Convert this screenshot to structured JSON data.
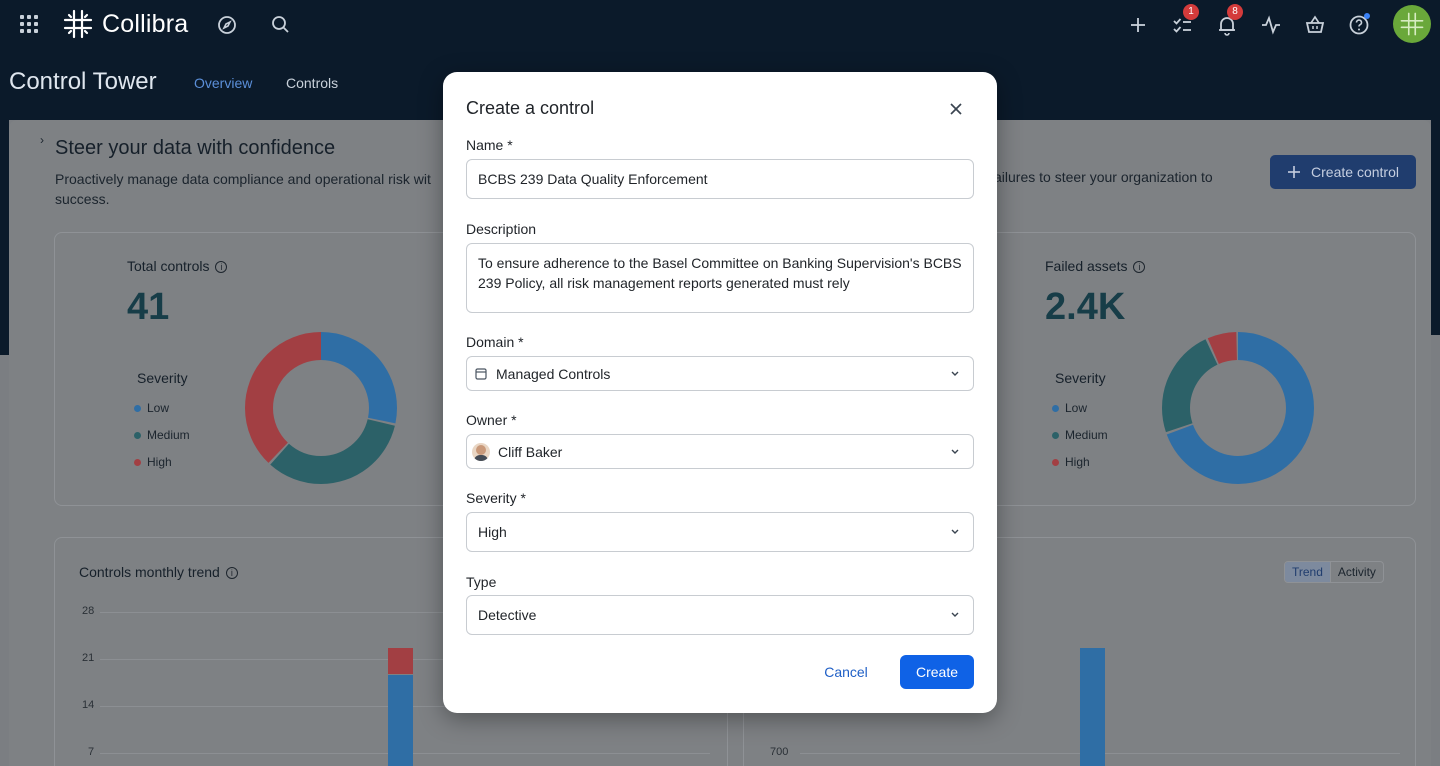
{
  "app": {
    "name": "Collibra"
  },
  "topbar": {
    "tasks_badge": "1",
    "notifications_badge": "8"
  },
  "header": {
    "title": "Control Tower",
    "tabs": [
      {
        "label": "Overview",
        "active": true
      },
      {
        "label": "Controls",
        "active": false
      }
    ]
  },
  "background": {
    "heading": "Steer your data with confidence",
    "subtitle_left": "Proactively manage data compliance and operational risk wit",
    "subtitle_right": "ailures to steer your organization to",
    "subtitle_wrap": "success.",
    "create_button": "Create control",
    "total_controls": {
      "label": "Total controls",
      "value": "41"
    },
    "failed_assets": {
      "label": "Failed assets",
      "value": "2.4K"
    },
    "severity_title": "Severity",
    "severity_legend": [
      "Low",
      "Medium",
      "High"
    ],
    "monthly_trend": {
      "label": "Controls monthly trend",
      "y_ticks": [
        "28",
        "21",
        "14",
        "7"
      ]
    },
    "right_chart_tick": "700",
    "toggle": [
      "Trend",
      "Activity"
    ]
  },
  "modal": {
    "title": "Create a control",
    "name": {
      "label": "Name *",
      "value": "BCBS 239 Data Quality Enforcement"
    },
    "description": {
      "label": "Description",
      "value": "To ensure adherence to the Basel Committee on Banking Supervision's BCBS 239 Policy, all risk management reports generated must rely"
    },
    "domain": {
      "label": "Domain *",
      "value": "Managed Controls"
    },
    "owner": {
      "label": "Owner *",
      "value": "Cliff Baker"
    },
    "severity": {
      "label": "Severity *",
      "value": "High"
    },
    "type": {
      "label": "Type",
      "value": "Detective"
    },
    "cancel": "Cancel",
    "create": "Create"
  },
  "colors": {
    "primary": "#0f62e6",
    "low": "#2f6ea5",
    "medium": "#2c6168",
    "high": "#a23f43"
  }
}
